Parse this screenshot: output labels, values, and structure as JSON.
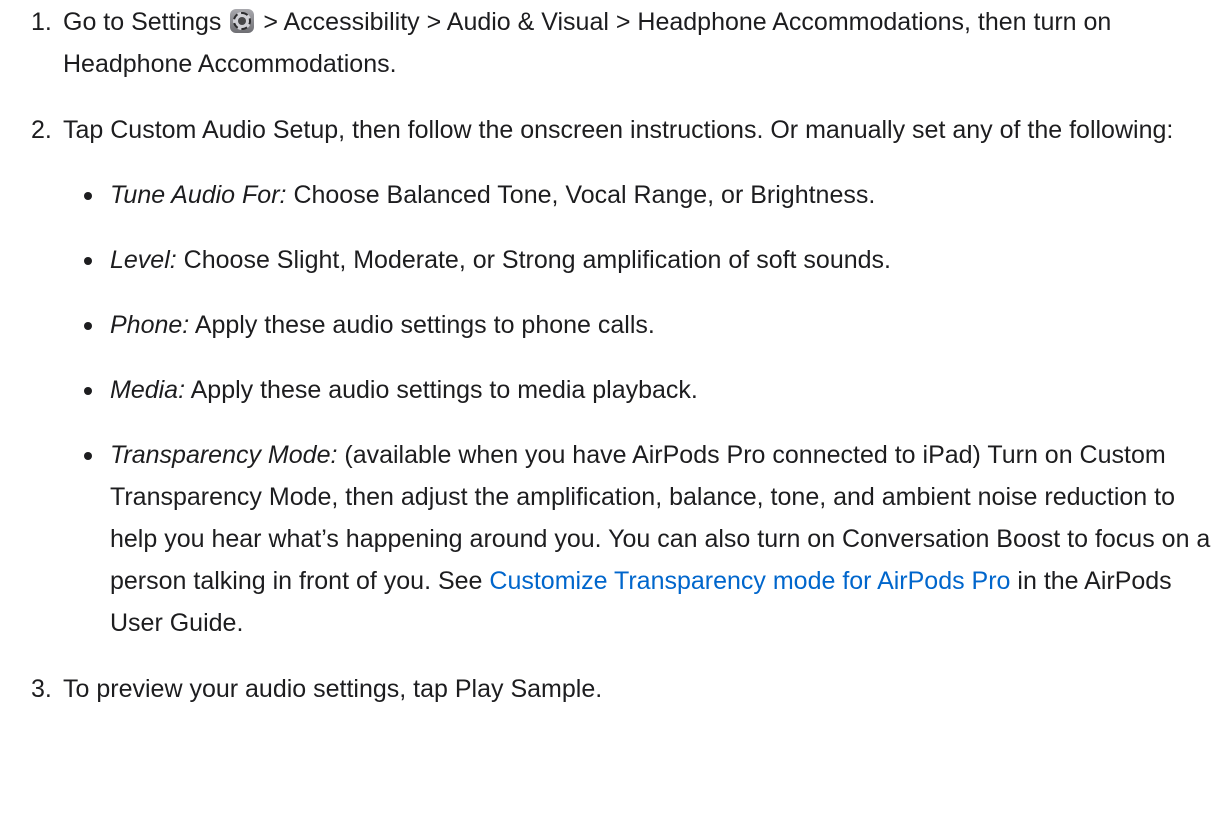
{
  "steps": [
    {
      "number": "1.",
      "text_before_icon": "Go to Settings",
      "icon": "settings-gear-icon",
      "text_after_icon": "> Accessibility > Audio & Visual > Headphone Accommodations, then turn on Headphone Accommodations."
    },
    {
      "number": "2.",
      "text": "Tap Custom Audio Setup, then follow the onscreen instructions. Or manually set any of the following:",
      "options": [
        {
          "term": "Tune Audio For:",
          "description": "Choose Balanced Tone, Vocal Range, or Brightness."
        },
        {
          "term": "Level:",
          "description": "Choose Slight, Moderate, or Strong amplification of soft sounds."
        },
        {
          "term": "Phone:",
          "description": "Apply these audio settings to phone calls."
        },
        {
          "term": "Media:",
          "description": "Apply these audio settings to media playback."
        },
        {
          "term": "Transparency Mode:",
          "description_before_link": "(available when you have AirPods Pro connected to iPad) Turn on Custom Transparency Mode, then adjust the amplification, balance, tone, and ambient noise reduction to help you hear what’s happening around you. You can also turn on Conversation Boost to focus on a person talking in front of you. See",
          "link": "Customize Transparency mode for AirPods Pro",
          "description_after_link": "in the AirPods User Guide."
        }
      ]
    },
    {
      "number": "3.",
      "text": "To preview your audio settings, tap Play Sample."
    }
  ],
  "colors": {
    "text": "#1d1d1f",
    "link": "#0066cc",
    "background": "#ffffff"
  }
}
